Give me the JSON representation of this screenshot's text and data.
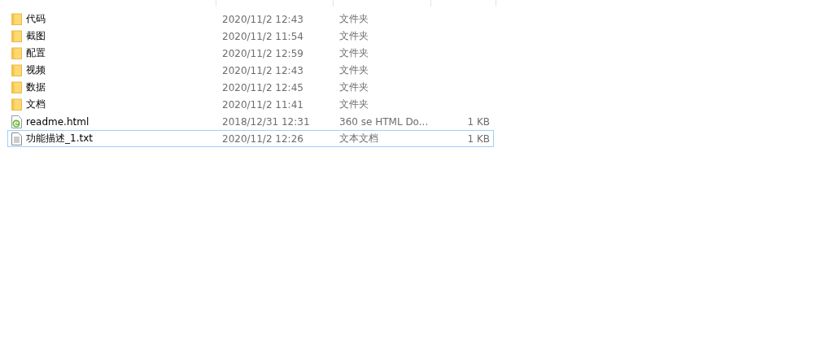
{
  "files": [
    {
      "name": "代码",
      "modified": "2020/11/2 12:43",
      "type": "文件夹",
      "kind": "folder",
      "focused": false
    },
    {
      "name": "截图",
      "modified": "2020/11/2 11:54",
      "type": "文件夹",
      "kind": "folder",
      "focused": false
    },
    {
      "name": "配置",
      "modified": "2020/11/2 12:59",
      "type": "文件夹",
      "kind": "folder",
      "focused": false
    },
    {
      "name": "视频",
      "modified": "2020/11/2 12:43",
      "type": "文件夹",
      "kind": "folder",
      "focused": false
    },
    {
      "name": "数据",
      "modified": "2020/11/2 12:45",
      "type": "文件夹",
      "kind": "folder",
      "focused": false
    },
    {
      "name": "文档",
      "modified": "2020/11/2 11:41",
      "type": "文件夹",
      "kind": "folder",
      "focused": false
    },
    {
      "name": "readme.html",
      "modified": "2018/12/31 12:31",
      "type": "360 se HTML Do...",
      "size": "1 KB",
      "kind": "html",
      "focused": false
    },
    {
      "name": "功能描述_1.txt",
      "modified": "2020/11/2 12:26",
      "type": "文本文档",
      "size": "1 KB",
      "kind": "text",
      "focused": true
    }
  ]
}
